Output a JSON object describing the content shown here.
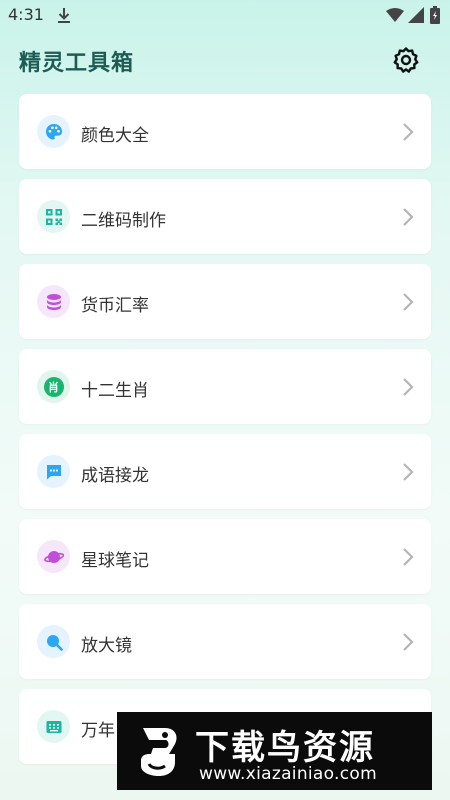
{
  "status_bar": {
    "time": "4:31"
  },
  "app": {
    "title": "精灵工具箱"
  },
  "menu": {
    "items": [
      {
        "label": "颜色大全",
        "icon": "palette-icon",
        "icon_color": "#2aa7f0",
        "bg": "#e4f3fd"
      },
      {
        "label": "二维码制作",
        "icon": "qrcode-icon",
        "icon_color": "#19b6a2",
        "bg": "#e2f7f3"
      },
      {
        "label": "货币汇率",
        "icon": "coins-icon",
        "icon_color": "#c34ddb",
        "bg": "#f6e6fa"
      },
      {
        "label": "十二生肖",
        "icon": "zodiac-icon",
        "icon_color": "#19b56e",
        "bg": "#e0f6ec"
      },
      {
        "label": "成语接龙",
        "icon": "chat-icon",
        "icon_color": "#2aa7f0",
        "bg": "#e4f3fd"
      },
      {
        "label": "星球笔记",
        "icon": "planet-icon",
        "icon_color": "#c34ddb",
        "bg": "#f6e6fa"
      },
      {
        "label": "放大镜",
        "icon": "magnifier-icon",
        "icon_color": "#2aa7f0",
        "bg": "#e4f3fd"
      },
      {
        "label": "万年",
        "icon": "calendar-icon",
        "icon_color": "#19b6a2",
        "bg": "#e2f7f3"
      }
    ],
    "zodiac_glyph": "肖"
  },
  "watermark": {
    "title": "下载鸟资源",
    "url": "www.xiazainiao.com"
  },
  "colors": {
    "title": "#1c5c55",
    "chevron": "#b5b5b5"
  }
}
